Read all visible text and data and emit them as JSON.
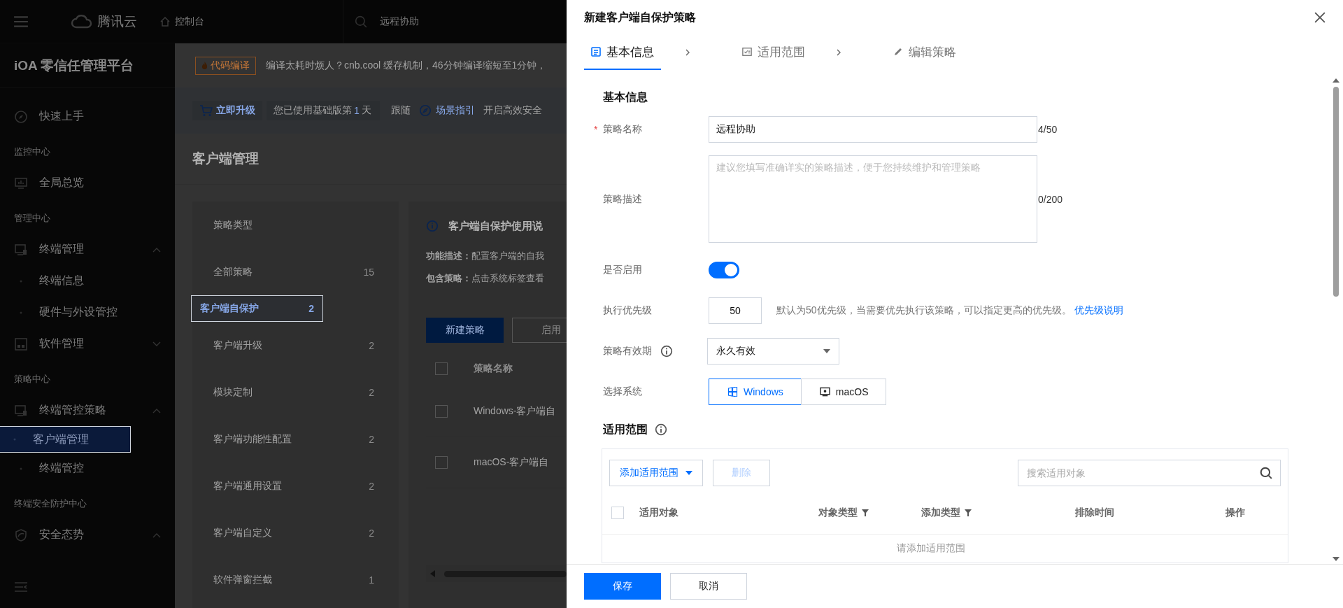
{
  "topbar": {
    "brand": "腾讯云",
    "console": "控制台",
    "search_value": "远程协助"
  },
  "sidebar": {
    "title": "iOA 零信任管理平台",
    "items": [
      {
        "kind": "item",
        "label": "快速上手",
        "selected": false
      },
      {
        "kind": "heading",
        "label": "监控中心"
      },
      {
        "kind": "item",
        "label": "全局总览",
        "selected": false
      },
      {
        "kind": "heading",
        "label": "管理中心"
      },
      {
        "kind": "parent",
        "label": "终端管理",
        "expanded": true,
        "selected": false
      },
      {
        "kind": "sub",
        "label": "终端信息",
        "selected": false
      },
      {
        "kind": "sub",
        "label": "硬件与外设管控",
        "selected": false
      },
      {
        "kind": "parent",
        "label": "软件管理",
        "expanded": false,
        "selected": false
      },
      {
        "kind": "heading",
        "label": "策略中心"
      },
      {
        "kind": "parent",
        "label": "终端管控策略",
        "expanded": true,
        "selected": false
      },
      {
        "kind": "sub",
        "label": "客户端管理",
        "selected": true
      },
      {
        "kind": "sub",
        "label": "终端管控",
        "selected": false
      },
      {
        "kind": "heading",
        "label": "终端安全防护中心"
      },
      {
        "kind": "parent",
        "label": "安全态势",
        "expanded": true,
        "selected": false
      }
    ]
  },
  "banner": {
    "tag": "代码编译",
    "text": "编译太耗时烦人？cnb.cool 缓存机制，46分钟编译缩短至1分钟，"
  },
  "upgrade": {
    "button": "立即升级",
    "usage_prefix": "您已使用基础版第",
    "usage_days": "1",
    "usage_suffix": "天",
    "follow": "跟随",
    "guide": "场景指引",
    "tail": "开启高效安全"
  },
  "page_title": "客户端管理",
  "policy_types": {
    "header": "策略类型",
    "items": [
      {
        "label": "全部策略",
        "count": "15",
        "selected": false
      },
      {
        "label": "客户端自保护",
        "count": "2",
        "selected": true
      },
      {
        "label": "客户端升级",
        "count": "2",
        "selected": false
      },
      {
        "label": "模块定制",
        "count": "2",
        "selected": false
      },
      {
        "label": "客户端功能性配置",
        "count": "2",
        "selected": false
      },
      {
        "label": "客户端通用设置",
        "count": "2",
        "selected": false
      },
      {
        "label": "客户端自定义",
        "count": "2",
        "selected": false
      },
      {
        "label": "软件弹窗拦截",
        "count": "1",
        "selected": false
      }
    ]
  },
  "info": {
    "title": "客户端自保护使用说",
    "lines": [
      {
        "label": "功能描述：",
        "text": "配置客户端的自我"
      },
      {
        "label": "包含策略：",
        "text": "点击系统标签查看"
      }
    ]
  },
  "actions": [
    {
      "label": "新建策略",
      "primary": true
    },
    {
      "label": "启用",
      "primary": false
    }
  ],
  "policy_table": {
    "column": "策略名称",
    "header_checked": false,
    "rows": [
      {
        "name": "Windows-客户端自",
        "checked": false
      },
      {
        "name": "macOS-客户端自",
        "checked": false
      }
    ]
  },
  "drawer": {
    "title": "新建客户端自保护策略",
    "steps": [
      {
        "label": "基本信息",
        "selected": true
      },
      {
        "label": "适用范围",
        "selected": false
      },
      {
        "label": "编辑策略",
        "selected": false
      }
    ],
    "section_basic": "基本信息",
    "name": {
      "label": "策略名称",
      "required_mark": "*",
      "value": "远程协助",
      "counter": "4/50"
    },
    "description": {
      "label": "策略描述",
      "placeholder": "建议您填写准确详实的策略描述，便于您持续维护和管理策略",
      "counter": "0/200"
    },
    "enabled": {
      "label": "是否启用",
      "on": true
    },
    "priority": {
      "label": "执行优先级",
      "value": "50",
      "help": "默认为50优先级，当需要优先执行该策略，可以指定更高的优先级。",
      "link": "优先级说明"
    },
    "validity": {
      "label": "策略有效期",
      "value": "永久有效"
    },
    "system": {
      "label": "选择系统",
      "options": [
        {
          "label": "Windows",
          "selected": true
        },
        {
          "label": "macOS",
          "selected": false
        }
      ]
    },
    "section_scope": "适用范围",
    "scope": {
      "add_button": "添加适用范围",
      "delete_button": {
        "label": "删除",
        "disabled": true
      },
      "search_placeholder": "搜索适用对象",
      "header_checked": false,
      "columns": [
        {
          "label": "适用对象",
          "filter": false
        },
        {
          "label": "对象类型",
          "filter": true
        },
        {
          "label": "添加类型",
          "filter": true
        },
        {
          "label": "排除时间",
          "filter": false
        },
        {
          "label": "操作",
          "filter": false
        }
      ],
      "empty": "请添加适用范围"
    },
    "footer": [
      {
        "label": "保存",
        "primary": true
      },
      {
        "label": "取消",
        "primary": false
      }
    ]
  }
}
